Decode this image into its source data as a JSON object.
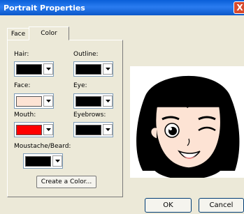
{
  "window": {
    "title": "Portrait Properties",
    "close_glyph": "X"
  },
  "tabs": [
    {
      "label": "Face"
    },
    {
      "label": "Color"
    }
  ],
  "colors": {
    "hair": {
      "label": "Hair:",
      "value": "#000000"
    },
    "outline": {
      "label": "Outline:",
      "value": "#000000"
    },
    "face": {
      "label": "Face:",
      "value": "#fde3d4"
    },
    "eye": {
      "label": "Eye:",
      "value": "#000000"
    },
    "mouth": {
      "label": "Mouth:",
      "value": "#ff0000"
    },
    "eyebrows": {
      "label": "Eyebrows:",
      "value": "#000000"
    },
    "moustache": {
      "label": "Moustache/Beard:",
      "value": "#000000"
    }
  },
  "buttons": {
    "create_color": "Create a Color...",
    "ok": "OK",
    "cancel": "Cancel"
  }
}
